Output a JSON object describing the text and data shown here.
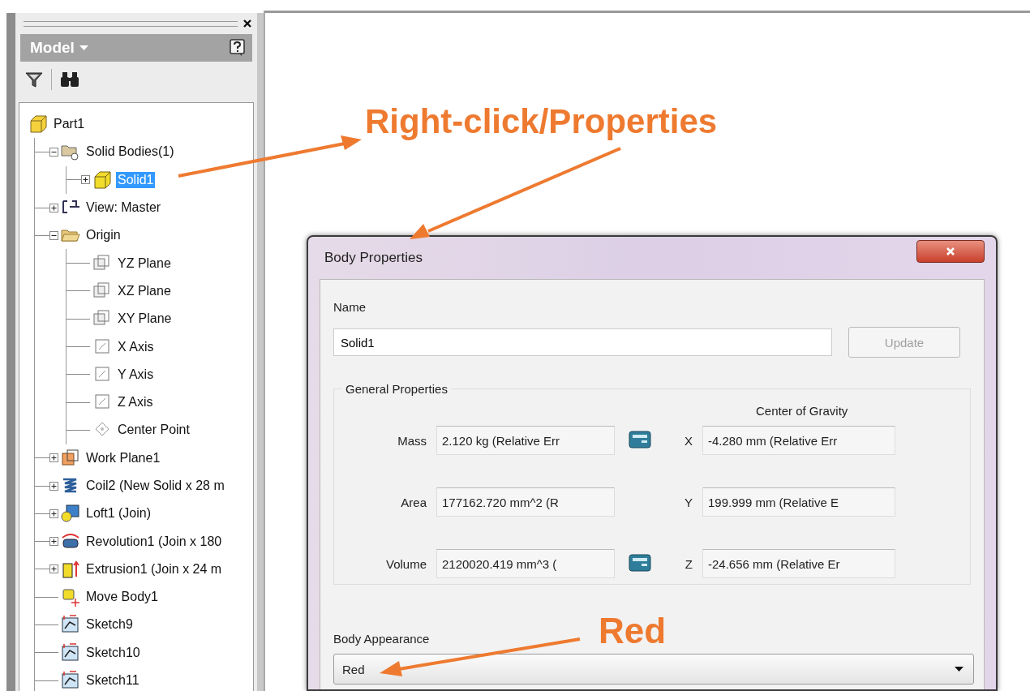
{
  "browser": {
    "title": "Model",
    "tree": [
      {
        "label": "Part1",
        "kind": "part",
        "selected": false,
        "children": [
          {
            "label": "Solid Bodies(1)",
            "kind": "bodies",
            "selected": false,
            "expanded": true,
            "children": [
              {
                "label": "Solid1",
                "kind": "body",
                "selected": true,
                "expanded": false
              }
            ]
          },
          {
            "label": "View: Master",
            "kind": "view",
            "selected": false,
            "expanded": false
          },
          {
            "label": "Origin",
            "kind": "folder",
            "selected": false,
            "expanded": true,
            "children": [
              {
                "label": "YZ Plane",
                "kind": "plane",
                "selected": false
              },
              {
                "label": "XZ Plane",
                "kind": "plane",
                "selected": false
              },
              {
                "label": "XY Plane",
                "kind": "plane",
                "selected": false
              },
              {
                "label": "X Axis",
                "kind": "axis",
                "selected": false
              },
              {
                "label": "Y Axis",
                "kind": "axis",
                "selected": false
              },
              {
                "label": "Z Axis",
                "kind": "axis",
                "selected": false
              },
              {
                "label": "Center Point",
                "kind": "point",
                "selected": false
              }
            ]
          },
          {
            "label": "Work Plane1",
            "kind": "workplane",
            "selected": false,
            "expanded": false
          },
          {
            "label": "Coil2 (New Solid x 28 m",
            "kind": "coil",
            "selected": false,
            "expanded": false
          },
          {
            "label": "Loft1 (Join)",
            "kind": "loft",
            "selected": false,
            "expanded": false
          },
          {
            "label": "Revolution1 (Join x 180",
            "kind": "revolve",
            "selected": false,
            "expanded": false
          },
          {
            "label": "Extrusion1 (Join x 24 m",
            "kind": "extrude",
            "selected": false,
            "expanded": false
          },
          {
            "label": "Move Body1",
            "kind": "move",
            "selected": false
          },
          {
            "label": "Sketch9",
            "kind": "sketch",
            "selected": false
          },
          {
            "label": "Sketch10",
            "kind": "sketch",
            "selected": false
          },
          {
            "label": "Sketch11",
            "kind": "sketch",
            "selected": false
          }
        ]
      }
    ]
  },
  "dialog": {
    "title": "Body Properties",
    "name_label": "Name",
    "name_value": "Solid1",
    "update_button": {
      "label": "Update",
      "disabled": true
    },
    "group_title": "General Properties",
    "cog_label": "Center of Gravity",
    "properties": [
      {
        "label": "Mass",
        "value": "2.120 kg (Relative Err",
        "copy": true,
        "axis": "X",
        "cog_value": "-4.280 mm (Relative Err"
      },
      {
        "label": "Area",
        "value": "177162.720 mm^2 (R",
        "copy": false,
        "axis": "Y",
        "cog_value": "199.999 mm (Relative E"
      },
      {
        "label": "Volume",
        "value": "2120020.419 mm^3 (",
        "copy": true,
        "axis": "Z",
        "cog_value": "-24.656 mm (Relative Er"
      }
    ],
    "appearance_label": "Body Appearance",
    "appearance": "Red"
  },
  "annotations": [
    {
      "text": "Right-click/Properties"
    },
    {
      "text": "Red"
    }
  ]
}
